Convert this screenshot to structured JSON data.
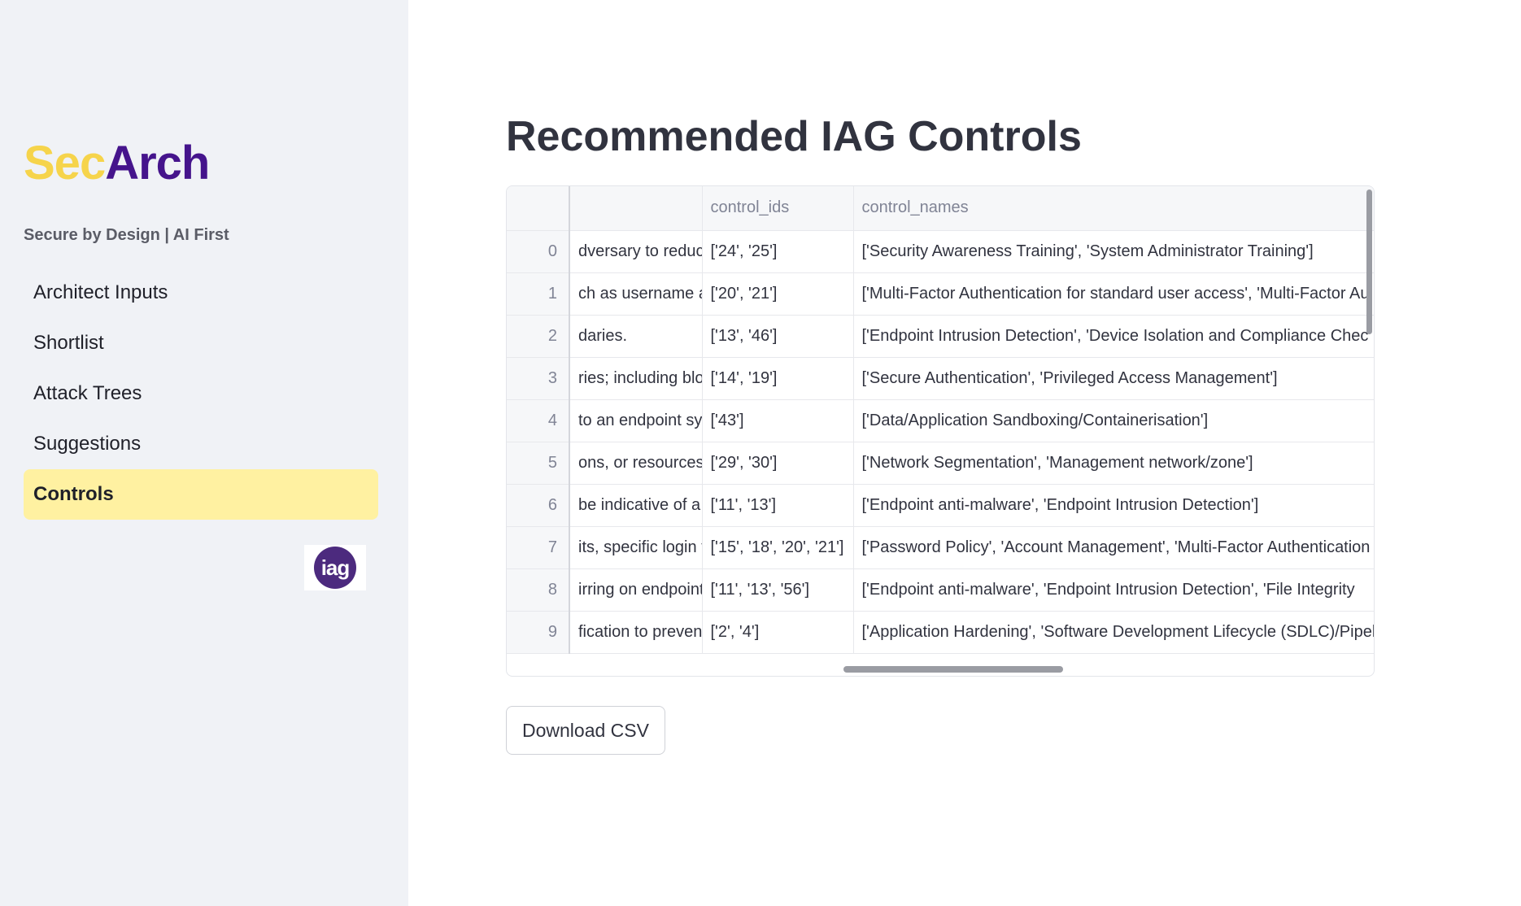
{
  "sidebar": {
    "brand_part1": "Sec",
    "brand_part2": "Arch",
    "tagline": "Secure by Design | AI First",
    "items": [
      {
        "label": "Architect Inputs"
      },
      {
        "label": "Shortlist"
      },
      {
        "label": "Attack Trees"
      },
      {
        "label": "Suggestions"
      },
      {
        "label": "Controls",
        "active": true
      }
    ],
    "logo_text": "iag"
  },
  "main": {
    "title": "Recommended IAG Controls",
    "columns": [
      "",
      "",
      "control_ids",
      "control_names"
    ],
    "rows": [
      {
        "index": "0",
        "desc": "dversary to reduce",
        "control_ids": "['24', '25']",
        "control_names": "['Security Awareness Training', 'System Administrator Training']"
      },
      {
        "index": "1",
        "desc": "ch as username ar",
        "control_ids": "['20', '21']",
        "control_names": "['Multi-Factor Authentication for standard user access', 'Multi-Factor Au"
      },
      {
        "index": "2",
        "desc": "daries.",
        "control_ids": "['13', '46']",
        "control_names": "['Endpoint Intrusion Detection', 'Device Isolation and Compliance Chec"
      },
      {
        "index": "3",
        "desc": "ries; including bloc",
        "control_ids": "['14', '19']",
        "control_names": "['Secure Authentication', 'Privileged Access Management']"
      },
      {
        "index": "4",
        "desc": "to an endpoint sys",
        "control_ids": "['43']",
        "control_names": "['Data/Application Sandboxing/Containerisation']"
      },
      {
        "index": "5",
        "desc": "ons, or resources. U",
        "control_ids": "['29', '30']",
        "control_names": "['Network Segmentation', 'Management network/zone']"
      },
      {
        "index": "6",
        "desc": "be indicative of a s",
        "control_ids": "['11', '13']",
        "control_names": "['Endpoint anti-malware', 'Endpoint Intrusion Detection']"
      },
      {
        "index": "7",
        "desc": "its, specific login ti",
        "control_ids": "['15', '18', '20', '21']",
        "control_names": "['Password Policy', 'Account Management', 'Multi-Factor Authentication"
      },
      {
        "index": "8",
        "desc": "irring on endpoint",
        "control_ids": "['11', '13', '56']",
        "control_names": "['Endpoint anti-malware', 'Endpoint Intrusion Detection', 'File Integrity"
      },
      {
        "index": "9",
        "desc": "fication to prevent",
        "control_ids": "['2', '4']",
        "control_names": "['Application Hardening', 'Software Development Lifecycle (SDLC)/Pipel"
      }
    ],
    "download_label": "Download CSV"
  },
  "colors": {
    "brand_yellow": "#f6d44b",
    "brand_purple": "#45148c",
    "active_nav_bg": "#fff1a1",
    "sidebar_bg": "#f0f2f6",
    "logo_purple": "#4c2a7e"
  },
  "icons": {
    "logo": "iag-logo-icon"
  }
}
